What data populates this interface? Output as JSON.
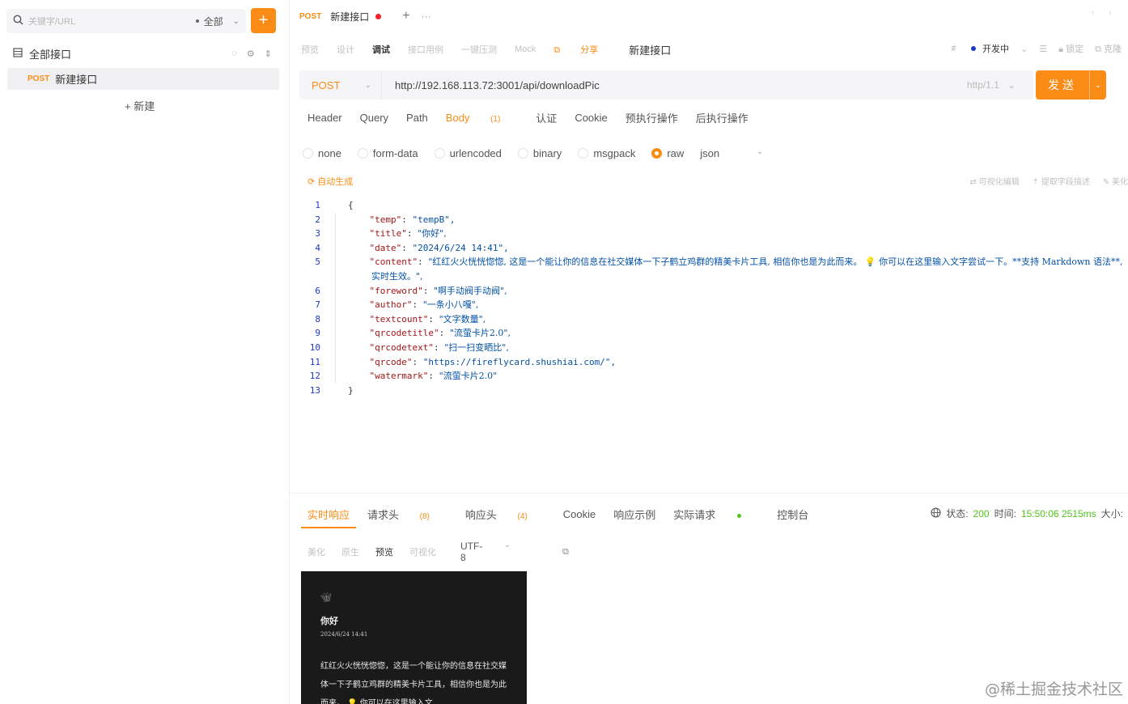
{
  "sidebar": {
    "search_placeholder": "关键字/URL",
    "scope": "全部",
    "add_label": "+",
    "root_label": "全部接口",
    "item": {
      "method": "POST",
      "name": "新建接口"
    },
    "new_label": "+ 新建"
  },
  "tab": {
    "method": "POST",
    "title": "新建接口",
    "plus": "+",
    "more": "···"
  },
  "window_controls": [
    "‹",
    "›"
  ],
  "modes": {
    "items": [
      "预览",
      "设计",
      "调试",
      "接口用例",
      "一键压测",
      "Mock"
    ],
    "active": "调试",
    "share": "分享",
    "api_name": "新建接口"
  },
  "env": {
    "name": "开发中",
    "lock": "锁定",
    "clone": "克隆"
  },
  "url": {
    "method": "POST",
    "value": "http://192.168.113.72:3001/api/downloadPic",
    "protocol": "http/1.1",
    "send_label": "发送"
  },
  "request_tabs": {
    "header": "Header",
    "query": "Query",
    "path": "Path",
    "body": "Body",
    "body_count": "(1)",
    "auth": "认证",
    "cookie": "Cookie",
    "pre": "预执行操作",
    "post": "后执行操作"
  },
  "body_types": {
    "none": "none",
    "form": "form-data",
    "urlencoded": "urlencoded",
    "binary": "binary",
    "msgpack": "msgpack",
    "raw": "raw",
    "json": "json"
  },
  "editor": {
    "autogen": "自动生成",
    "tools": [
      "可视化编辑",
      "提取字段描述",
      "美化"
    ],
    "open_brace": "{",
    "close_brace": "}",
    "lines": [
      {
        "n": "1"
      },
      {
        "n": "2",
        "k": "\"temp\"",
        "v": "\"tempB\","
      },
      {
        "n": "3",
        "k": "\"title\"",
        "v": "\"你好\","
      },
      {
        "n": "4",
        "k": "\"date\"",
        "v": "\"2024/6/24 14:41\","
      },
      {
        "n": "5",
        "k": "\"content\"",
        "v": "\"红红火火恍恍惚惚, 这是一个能让你的信息在社交媒体一下子鹤立鸡群的精美卡片工具, 相信你也是为此而来。 💡 你可以在这里输入文字尝试一下。**支持 Markdown 语法**, 实时生效。\","
      },
      {
        "n": "6",
        "k": "\"foreword\"",
        "v": "\"啊手动阀手动阀\","
      },
      {
        "n": "7",
        "k": "\"author\"",
        "v": "\"一条小八嘎\","
      },
      {
        "n": "8",
        "k": "\"textcount\"",
        "v": "\"文字数量\","
      },
      {
        "n": "9",
        "k": "\"qrcodetitle\"",
        "v": "\"流萤卡片2.0\","
      },
      {
        "n": "10",
        "k": "\"qrcodetext\"",
        "v": "\"扫一扫变晒比\","
      },
      {
        "n": "11",
        "k": "\"qrcode\"",
        "v": "\"https://fireflycard.shushiai.com/\","
      },
      {
        "n": "12",
        "k": "\"watermark\"",
        "v": "\"流萤卡片2.0\""
      },
      {
        "n": "13"
      }
    ]
  },
  "response_tabs": {
    "live": "实时响应",
    "req_headers": "请求头",
    "req_headers_count": "(8)",
    "resp_headers": "响应头",
    "resp_headers_count": "(4)",
    "cookie": "Cookie",
    "example": "响应示例",
    "actual": "实际请求",
    "console": "控制台"
  },
  "status": {
    "label": "状态:",
    "code": "200",
    "time_label": "时间:",
    "time": "15:50:06 2515ms",
    "size_label": "大小:"
  },
  "view_modes": {
    "items": [
      "美化",
      "原生",
      "预览",
      "可视化"
    ],
    "active": "预览",
    "encoding": "UTF-8"
  },
  "preview": {
    "title": "你好",
    "date": "2024/6/24 14:41",
    "text": "红红火火恍恍惚惚，这是一个能让你的信息在社交媒体一下子鹤立鸡群的精美卡片工具，相信你也是为此而来。 💡 你可以在这里输入文"
  },
  "watermark": "@稀土掘金技术社区",
  "colors": {
    "accent": "#fa8c16",
    "success": "#52c41a",
    "danger": "#f5222d",
    "line_number": "#1d39c4"
  }
}
